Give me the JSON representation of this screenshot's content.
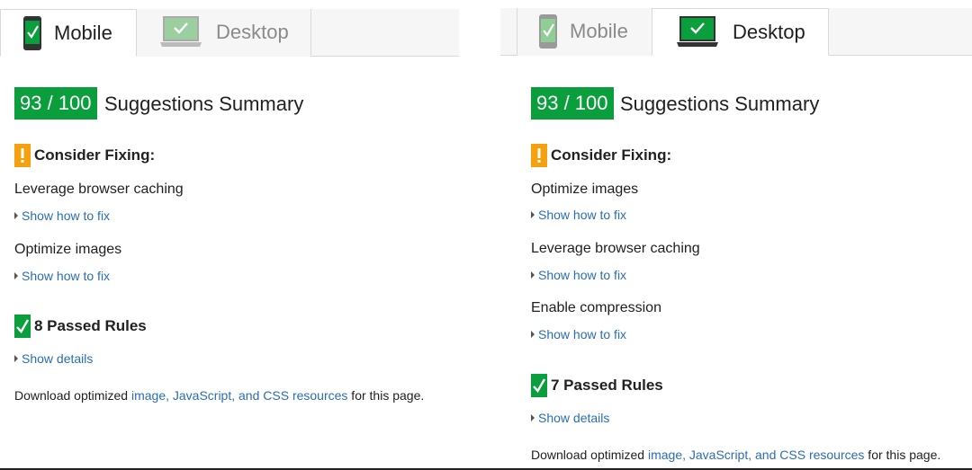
{
  "panels": [
    {
      "tabs": [
        {
          "label": "Mobile",
          "active": true,
          "icon": "phone-check-icon"
        },
        {
          "label": "Desktop",
          "active": false,
          "icon": "monitor-check-icon"
        }
      ],
      "score": "93 / 100",
      "summary_title": "Suggestions Summary",
      "consider_title": "Consider Fixing:",
      "rules": [
        "Leverage browser caching",
        "Optimize images"
      ],
      "show_fix_label": "Show how to fix",
      "passed_title": "8 Passed Rules",
      "show_details_label": "Show details",
      "footer": {
        "before": "Download optimized ",
        "link": "image, JavaScript, and CSS resources",
        "after": " for this page."
      }
    },
    {
      "tabs": [
        {
          "label": "Mobile",
          "active": false,
          "icon": "phone-check-icon"
        },
        {
          "label": "Desktop",
          "active": true,
          "icon": "monitor-check-icon"
        }
      ],
      "score": "93 / 100",
      "summary_title": "Suggestions Summary",
      "consider_title": "Consider Fixing:",
      "rules": [
        "Optimize images",
        "Leverage browser caching",
        "Enable compression"
      ],
      "show_fix_label": "Show how to fix",
      "passed_title": "7 Passed Rules",
      "show_details_label": "Show details",
      "footer": {
        "before": "Download optimized ",
        "link": "image, JavaScript, and CSS resources",
        "after": " for this page."
      }
    }
  ],
  "colors": {
    "score_green": "#0b9e3c",
    "warning_orange": "#f5a00f",
    "link_blue": "#2a6db8"
  }
}
